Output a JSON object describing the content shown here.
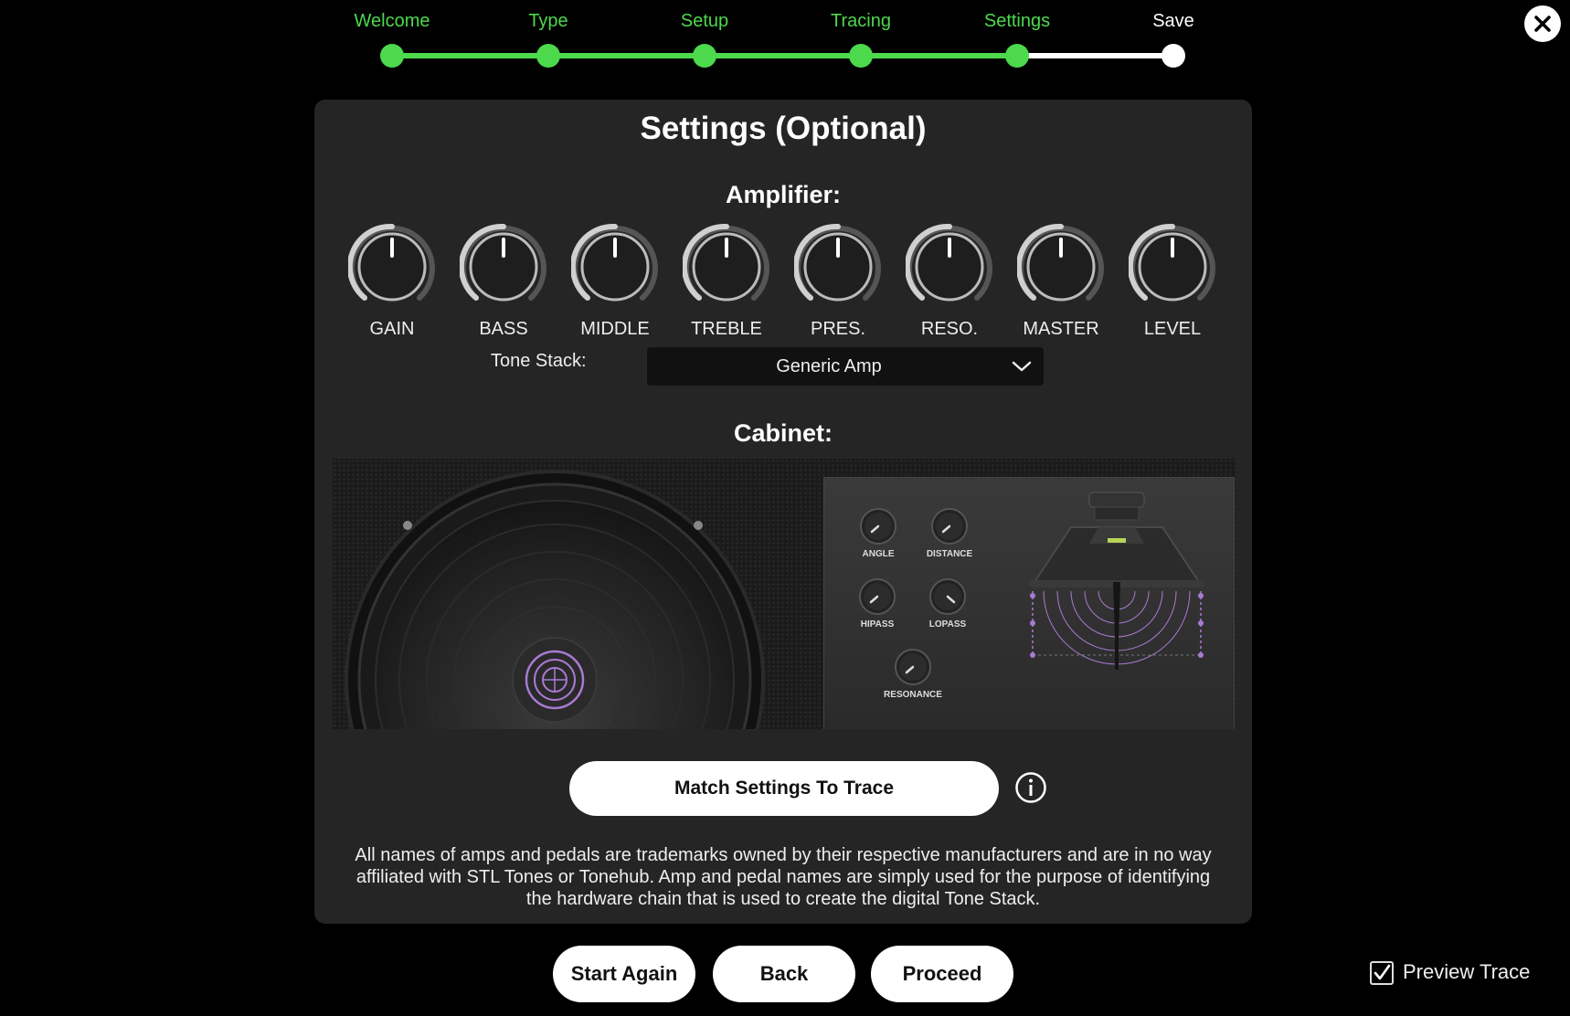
{
  "stepper": {
    "steps": [
      {
        "label": "Welcome",
        "state": "done"
      },
      {
        "label": "Type",
        "state": "done"
      },
      {
        "label": "Setup",
        "state": "done"
      },
      {
        "label": "Tracing",
        "state": "done"
      },
      {
        "label": "Settings",
        "state": "current"
      },
      {
        "label": "Save",
        "state": "pending"
      }
    ],
    "active_color": "#4cd94c",
    "pending_color": "#ffffff"
  },
  "close_icon": "close-icon",
  "panel": {
    "title": "Settings (Optional)",
    "amplifier": {
      "title": "Amplifier:",
      "knobs": [
        "GAIN",
        "BASS",
        "MIDDLE",
        "TREBLE",
        "PRES.",
        "RESO.",
        "MASTER",
        "LEVEL"
      ],
      "knob_position_percent": 50
    },
    "tone_stack": {
      "label": "Tone Stack:",
      "value": "Generic Amp"
    },
    "cabinet": {
      "title": "Cabinet:",
      "controls": [
        "ANGLE",
        "DISTANCE",
        "HIPASS",
        "LOPASS",
        "RESONANCE"
      ],
      "accent_color": "#a97ad4"
    },
    "match_button": "Match Settings To Trace",
    "info_icon": "info-icon",
    "disclaimer": "All names of amps and pedals are trademarks owned by their respective manufacturers and are in no way affiliated with STL Tones or Tonehub. Amp and pedal names are simply used for the purpose of identifying the hardware chain that is used to create the digital Tone Stack."
  },
  "buttons": {
    "start_again": "Start Again",
    "back": "Back",
    "proceed": "Proceed"
  },
  "preview": {
    "label": "Preview Trace",
    "checked": true
  }
}
